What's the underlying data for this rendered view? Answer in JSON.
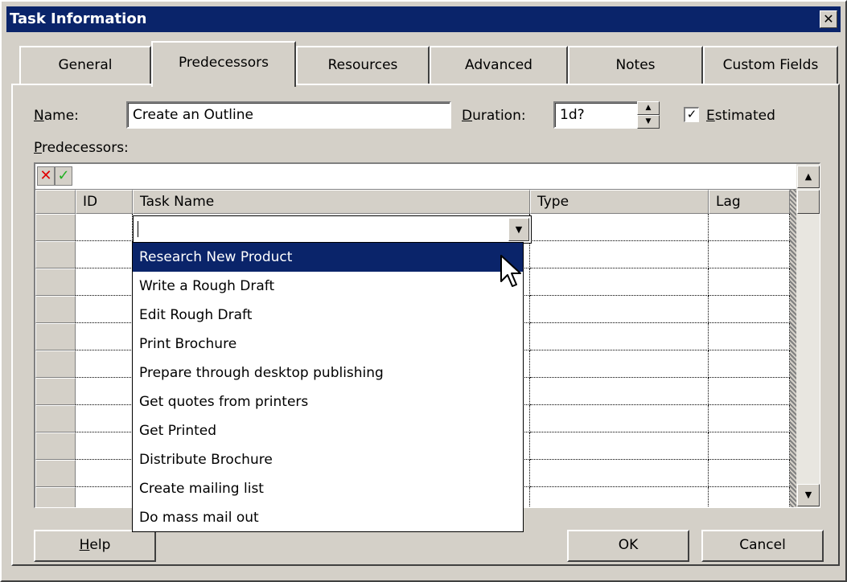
{
  "window": {
    "title": "Task Information",
    "close_glyph": "✕"
  },
  "tabs": [
    {
      "label": "General"
    },
    {
      "label": "Predecessors"
    },
    {
      "label": "Resources"
    },
    {
      "label": "Advanced"
    },
    {
      "label": "Notes"
    },
    {
      "label": "Custom Fields"
    }
  ],
  "active_tab": "Predecessors",
  "form": {
    "name_label_accel": "N",
    "name_label_rest": "ame:",
    "name_value": "Create an Outline",
    "duration_label_accel": "D",
    "duration_label_rest": "uration:",
    "duration_value": "1d?",
    "estimated_label_accel": "E",
    "estimated_label_rest": "stimated",
    "estimated_checked": true,
    "predecessors_label_accel": "P",
    "predecessors_label_rest": "redecessors:"
  },
  "grid": {
    "columns": [
      "ID",
      "Task Name",
      "Type",
      "Lag"
    ],
    "edit_cancel_glyph": "✕",
    "edit_accept_glyph": "✓"
  },
  "dropdown": {
    "selected_index": 0,
    "items": [
      "Research New Product",
      "Write a Rough Draft",
      "Edit Rough Draft",
      "Print Brochure",
      "Prepare through desktop publishing",
      "Get quotes from printers",
      "Get Printed",
      "Distribute Brochure",
      "Create mailing list",
      "Do mass mail out"
    ]
  },
  "buttons": {
    "help_accel": "H",
    "help_rest": "elp",
    "ok": "OK",
    "cancel": "Cancel"
  },
  "icons": {
    "dropdown_arrow": "▼",
    "scroll_up": "▲",
    "scroll_down": "▼",
    "spin_up": "▲",
    "spin_down": "▼",
    "check": "✓"
  }
}
